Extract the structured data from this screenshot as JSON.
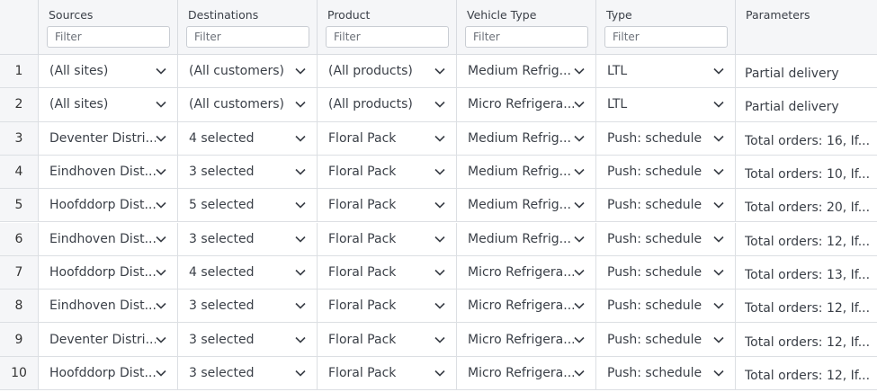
{
  "columns": [
    {
      "label": "Sources",
      "placeholder": "Filter"
    },
    {
      "label": "Destinations",
      "placeholder": "Filter"
    },
    {
      "label": "Product",
      "placeholder": "Filter"
    },
    {
      "label": "Vehicle Type",
      "placeholder": "Filter"
    },
    {
      "label": "Type",
      "placeholder": "Filter"
    },
    {
      "label": "Parameters",
      "placeholder": ""
    }
  ],
  "rows": [
    {
      "num": "1",
      "source": "(All sites)",
      "dest": "(All customers)",
      "product": "(All products)",
      "vehicle": "Medium Refrig...",
      "type": "LTL",
      "params": "Partial delivery"
    },
    {
      "num": "2",
      "source": "(All sites)",
      "dest": "(All customers)",
      "product": "(All products)",
      "vehicle": "Micro Refrigera...",
      "type": "LTL",
      "params": "Partial delivery"
    },
    {
      "num": "3",
      "source": "Deventer Distri...",
      "dest": "4 selected",
      "product": "Floral Pack",
      "vehicle": "Medium Refrig...",
      "type": "Push: schedule",
      "params": "Total orders: 16, If..."
    },
    {
      "num": "4",
      "source": "Eindhoven Dist...",
      "dest": "3 selected",
      "product": "Floral Pack",
      "vehicle": "Medium Refrig...",
      "type": "Push: schedule",
      "params": "Total orders: 10, If..."
    },
    {
      "num": "5",
      "source": "Hoofddorp Dist...",
      "dest": "5 selected",
      "product": "Floral Pack",
      "vehicle": "Medium Refrig...",
      "type": "Push: schedule",
      "params": "Total orders: 20, If..."
    },
    {
      "num": "6",
      "source": "Eindhoven Dist...",
      "dest": "3 selected",
      "product": "Floral Pack",
      "vehicle": "Medium Refrig...",
      "type": "Push: schedule",
      "params": "Total orders: 12, If..."
    },
    {
      "num": "7",
      "source": "Hoofddorp Dist...",
      "dest": "4 selected",
      "product": "Floral Pack",
      "vehicle": "Micro Refrigera...",
      "type": "Push: schedule",
      "params": "Total orders: 13, If..."
    },
    {
      "num": "8",
      "source": "Eindhoven Dist...",
      "dest": "3 selected",
      "product": "Floral Pack",
      "vehicle": "Micro Refrigera...",
      "type": "Push: schedule",
      "params": "Total orders: 12, If..."
    },
    {
      "num": "9",
      "source": "Deventer Distri...",
      "dest": "3 selected",
      "product": "Floral Pack",
      "vehicle": "Micro Refrigera...",
      "type": "Push: schedule",
      "params": "Total orders: 12, If..."
    },
    {
      "num": "10",
      "source": "Hoofddorp Dist...",
      "dest": "3 selected",
      "product": "Floral Pack",
      "vehicle": "Micro Refrigera...",
      "type": "Push: schedule",
      "params": "Total orders: 12, If..."
    }
  ],
  "icons": {
    "dropdown": "chevron-down-icon"
  },
  "colors": {
    "header_bg": "#f5f6f8",
    "border": "#dcdfe3",
    "text": "#3a3f47"
  }
}
